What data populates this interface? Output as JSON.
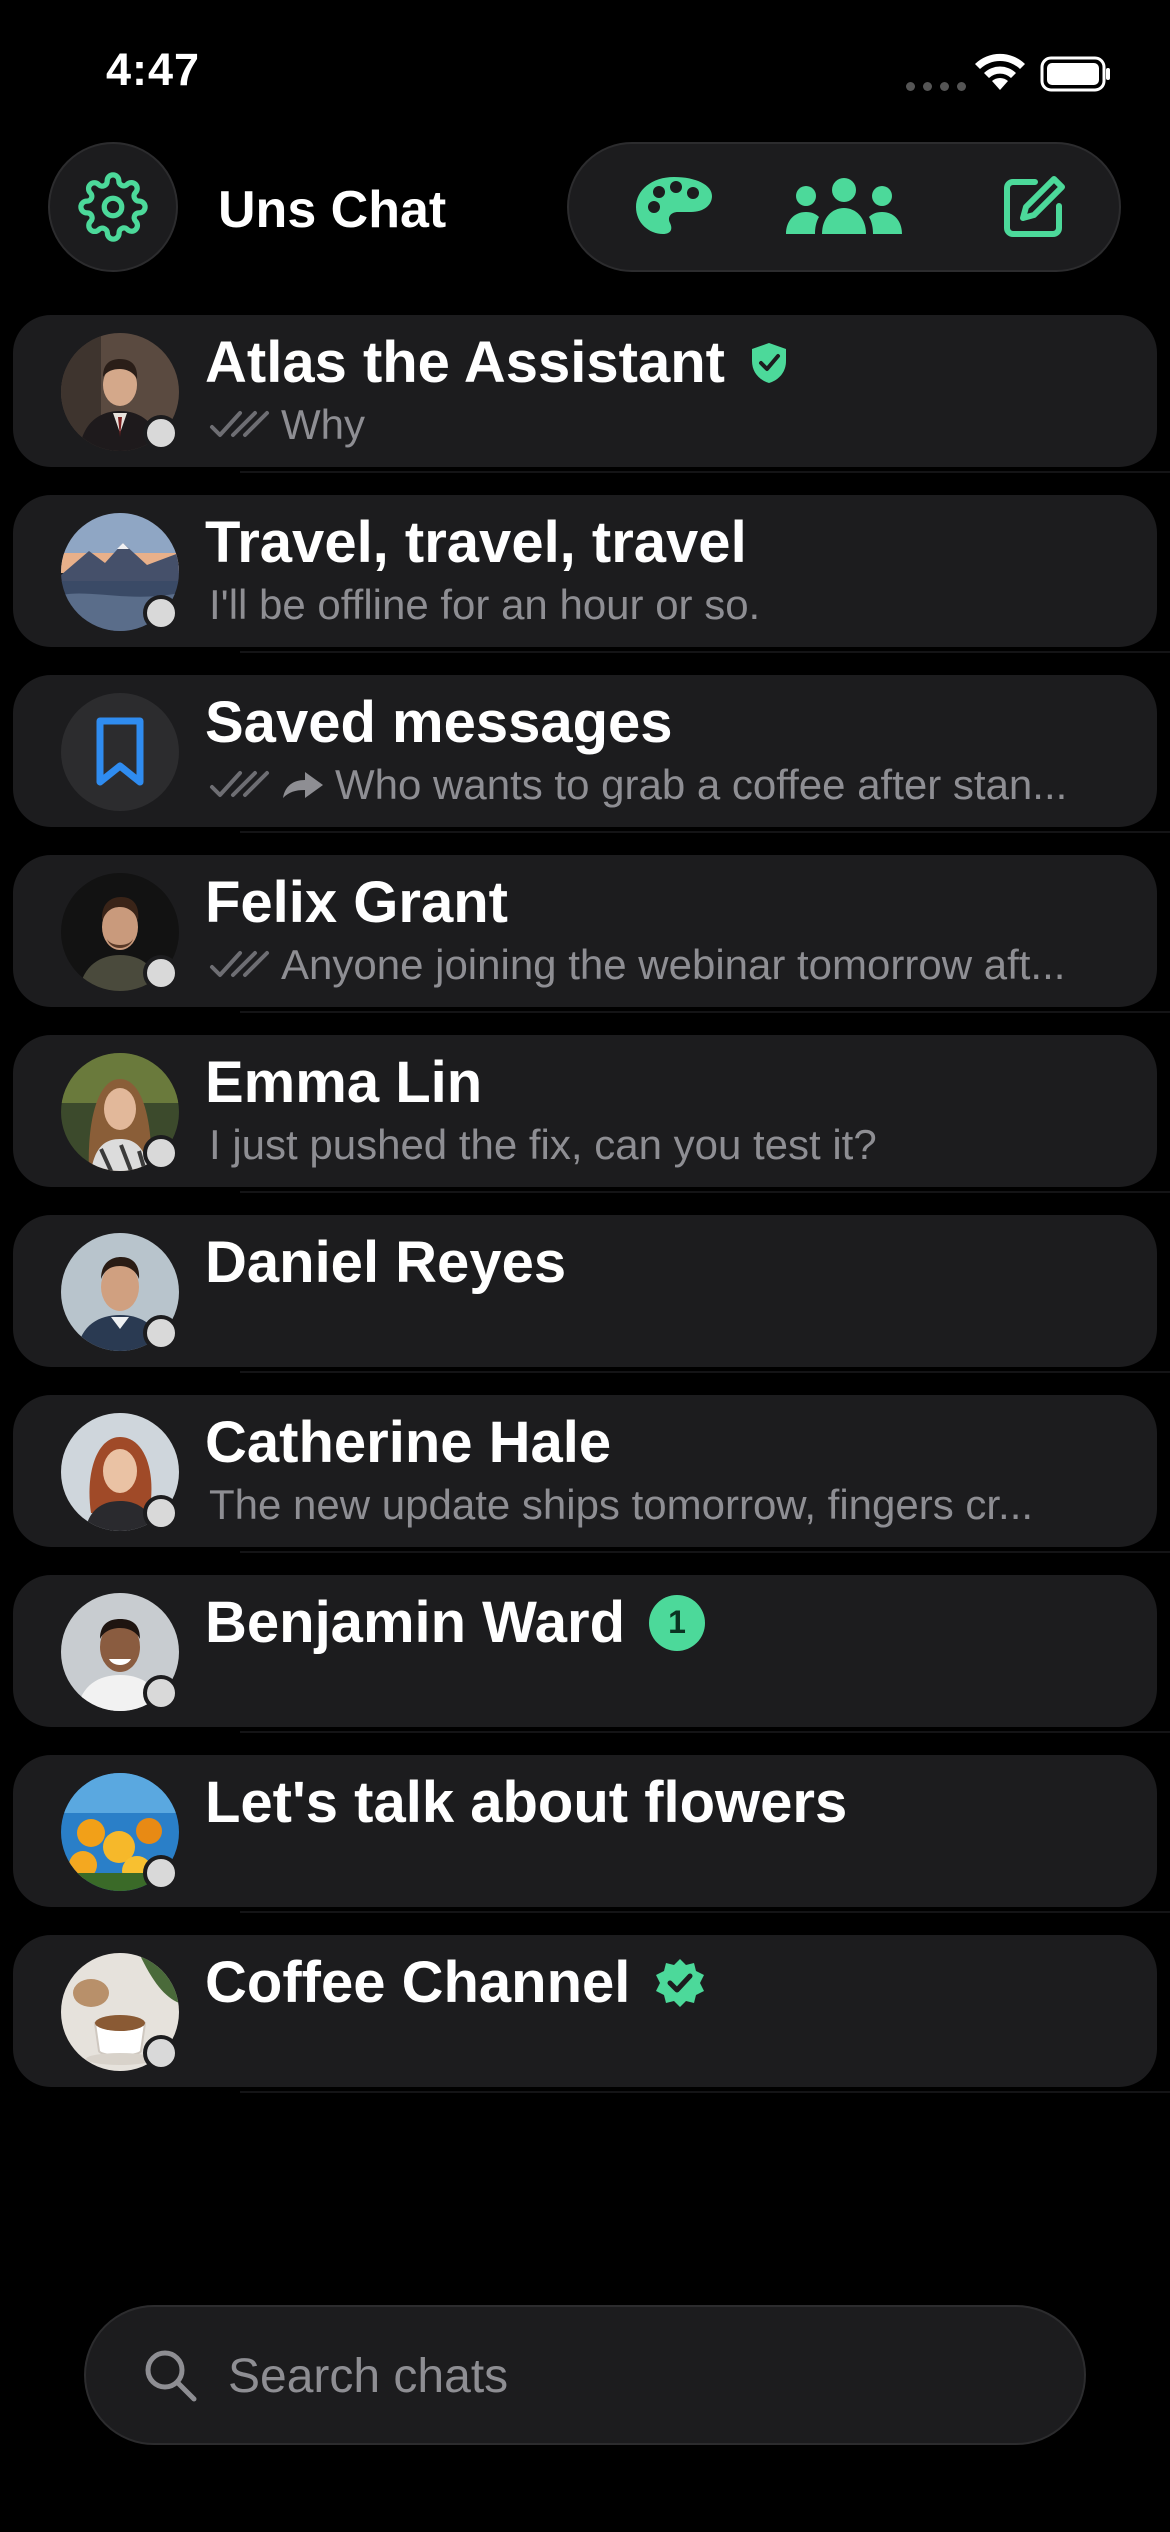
{
  "status_bar": {
    "time": "4:47"
  },
  "header": {
    "title": "Uns Chat"
  },
  "icons": {
    "settings": "gear-icon",
    "palette": "palette-icon",
    "groups": "people-icon",
    "compose": "compose-icon",
    "search": "search-icon"
  },
  "colors": {
    "accent": "#4cd99a",
    "background": "#000000",
    "card": "#1c1c1e",
    "secondary_text": "#8e8e93",
    "saved_icon": "#2f8cf0"
  },
  "chats": [
    {
      "name": "Atlas the Assistant",
      "preview": "Why",
      "read_ticks": true,
      "forwarded": false,
      "verified": "shield",
      "unread": ""
    },
    {
      "name": "Travel, travel, travel",
      "preview": "I'll be offline for an hour or so.",
      "read_ticks": false,
      "forwarded": false,
      "verified": "",
      "unread": ""
    },
    {
      "name": "Saved messages",
      "preview": "Who wants to grab a coffee after stan...",
      "read_ticks": true,
      "forwarded": true,
      "verified": "",
      "unread": ""
    },
    {
      "name": "Felix Grant",
      "preview": "Anyone joining the webinar tomorrow aft...",
      "read_ticks": true,
      "forwarded": false,
      "verified": "",
      "unread": ""
    },
    {
      "name": "Emma Lin",
      "preview": "I just pushed the fix, can you test it?",
      "read_ticks": false,
      "forwarded": false,
      "verified": "",
      "unread": ""
    },
    {
      "name": "Daniel Reyes",
      "preview": "",
      "read_ticks": false,
      "forwarded": false,
      "verified": "",
      "unread": ""
    },
    {
      "name": "Catherine Hale",
      "preview": "The new update ships tomorrow, fingers cr...",
      "read_ticks": false,
      "forwarded": false,
      "verified": "",
      "unread": ""
    },
    {
      "name": "Benjamin Ward",
      "preview": "",
      "read_ticks": false,
      "forwarded": false,
      "verified": "",
      "unread": "1"
    },
    {
      "name": "Let's talk about flowers",
      "preview": "",
      "read_ticks": false,
      "forwarded": false,
      "verified": "",
      "unread": ""
    },
    {
      "name": "Coffee Channel",
      "preview": "",
      "read_ticks": false,
      "forwarded": false,
      "verified": "seal",
      "unread": ""
    }
  ],
  "search": {
    "placeholder": "Search chats",
    "value": ""
  }
}
